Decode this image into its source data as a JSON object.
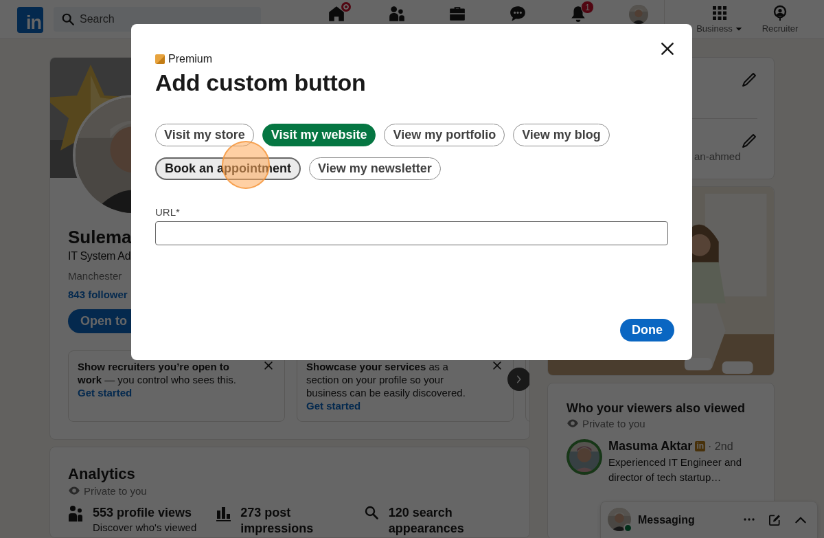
{
  "nav": {
    "logo": "in",
    "search_placeholder": "Search",
    "items": [
      {
        "kind": "home",
        "dot": true
      },
      {
        "kind": "network",
        "dot": false
      },
      {
        "kind": "jobs",
        "dot": false
      },
      {
        "kind": "messages",
        "dot": false
      },
      {
        "kind": "notifications",
        "dot": false,
        "count": "1"
      },
      {
        "kind": "avatar",
        "dot": false
      }
    ],
    "right_items": [
      {
        "kind": "grid",
        "label": "Business",
        "dropdown": true
      },
      {
        "kind": "recruiter",
        "label": "Recruiter",
        "dropdown": false
      }
    ]
  },
  "profile": {
    "name": "Sulema",
    "headline": "IT System Ad",
    "location": "Manchester",
    "followers": "843 follower",
    "open_button": "Open to",
    "promo_cards": [
      {
        "text": "**Show recruiters you’re open to work** — you control who sees this.",
        "link": "Get started"
      },
      {
        "text": "**Showcase your services** as a section on your profile so your business can be easily discovered.",
        "link": "Get started"
      }
    ]
  },
  "analytics": {
    "title": "Analytics",
    "privacy": "Private to you",
    "stats": [
      {
        "kind": "people",
        "title": "553 profile views",
        "subtitle": "Discover who's viewed"
      },
      {
        "kind": "chart",
        "title": "273 post impressions"
      },
      {
        "kind": "search",
        "title": "120 search appearances"
      }
    ]
  },
  "profile_links": {
    "url_fragment": "an-ahmed"
  },
  "viewers": {
    "title": "Who your viewers also viewed",
    "privacy": "Private to you",
    "person": {
      "name": "Masuma Aktar",
      "badge": "in",
      "degree": "· 2nd",
      "headline": "Experienced IT Engineer and director of tech startup…"
    }
  },
  "messaging": {
    "label": "Messaging",
    "online": true
  },
  "modal": {
    "badge": "Premium",
    "title": "Add custom button",
    "options": [
      {
        "label": "Visit my store",
        "selected": false,
        "focused": false
      },
      {
        "label": "Visit my website",
        "selected": true,
        "focused": false
      },
      {
        "label": "View my portfolio",
        "selected": false,
        "focused": false
      },
      {
        "label": "View my blog",
        "selected": false,
        "focused": false
      },
      {
        "label": "Book an appointment",
        "selected": false,
        "focused": true
      },
      {
        "label": "View my newsletter",
        "selected": false,
        "focused": false
      }
    ],
    "field_label": "URL*",
    "done": "Done"
  }
}
